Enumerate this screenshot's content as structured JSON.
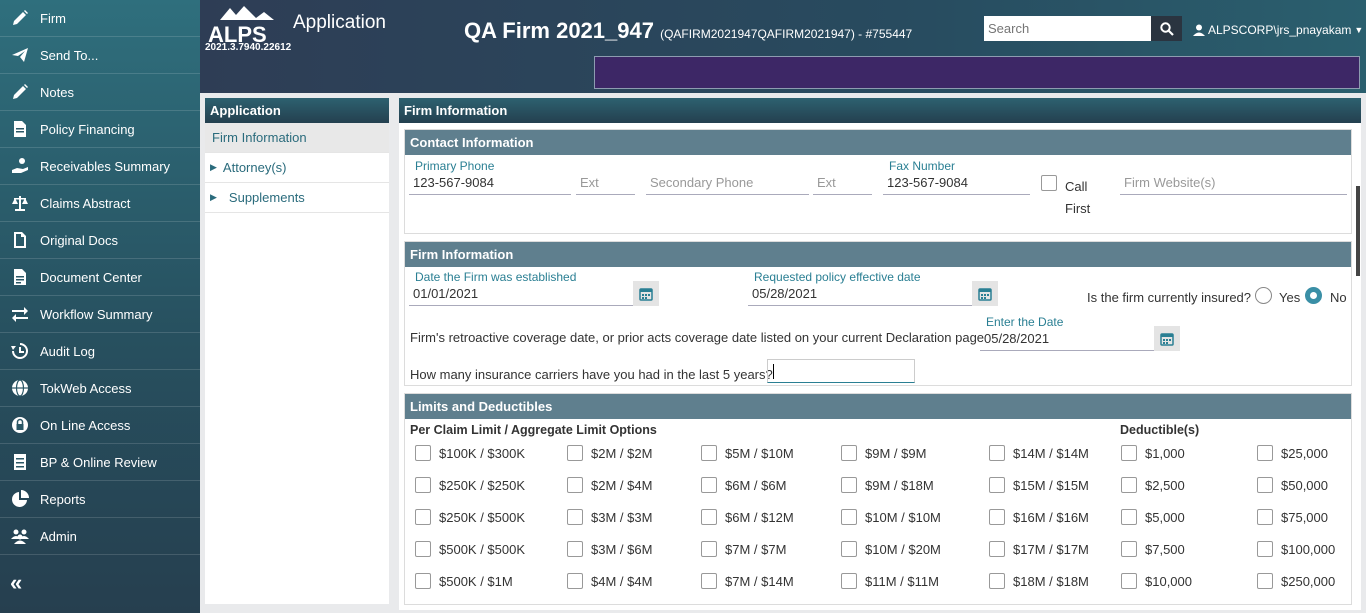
{
  "sidebar": {
    "items": [
      {
        "label": "Firm",
        "icon": "pencil-icon"
      },
      {
        "label": "Send To...",
        "icon": "paper-plane-icon"
      },
      {
        "label": "Notes",
        "icon": "pencil-icon"
      },
      {
        "label": "Policy Financing",
        "icon": "document-icon"
      },
      {
        "label": "Receivables Summary",
        "icon": "hand-coin-icon"
      },
      {
        "label": "Claims Abstract",
        "icon": "scale-icon"
      },
      {
        "label": "Original Docs",
        "icon": "file-icon"
      },
      {
        "label": "Document Center",
        "icon": "file-text-icon"
      },
      {
        "label": "Workflow Summary",
        "icon": "exchange-icon"
      },
      {
        "label": "Audit Log",
        "icon": "history-icon"
      },
      {
        "label": "TokWeb Access",
        "icon": "globe-icon"
      },
      {
        "label": "On Line Access",
        "icon": "lock-icon"
      },
      {
        "label": "BP & Online Review",
        "icon": "list-doc-icon"
      },
      {
        "label": "Reports",
        "icon": "pie-chart-icon"
      },
      {
        "label": "Admin",
        "icon": "users-icon"
      }
    ],
    "collapse_label": "«"
  },
  "header": {
    "logo_text": "ALPS",
    "app_title": "Application",
    "version": "2021.3.7940.22612",
    "firm_title": "QA Firm 2021_947",
    "firm_sub": "(QAFIRM2021947QAFIRM2021947) - #755447",
    "search_placeholder": "Search",
    "user": "ALPSCORP\\jrs_pnayakam"
  },
  "appnav": {
    "title": "Application",
    "items": [
      {
        "label": "Firm Information"
      },
      {
        "label": "Attorney(s)"
      },
      {
        "label": "Supplements"
      }
    ]
  },
  "main": {
    "title": "Firm Information",
    "contact": {
      "title": "Contact Information",
      "primary_phone_label": "Primary Phone",
      "primary_phone": "123-567-9084",
      "ext_placeholder": "Ext",
      "secondary_placeholder": "Secondary Phone",
      "ext2_placeholder": "Ext",
      "fax_label": "Fax Number",
      "fax": "123-567-9084",
      "call_first": "Call First",
      "website_placeholder": "Firm Website(s)"
    },
    "firm": {
      "title": "Firm Information",
      "established_label": "Date the Firm was established",
      "established": "01/01/2021",
      "effective_label": "Requested policy effective date",
      "effective": "05/28/2021",
      "insured_q": "Is the firm currently insured?",
      "yes": "Yes",
      "no": "No",
      "insured_value": "No",
      "retro_q": "Firm's retroactive coverage date, or prior acts coverage date listed on your current Declaration page",
      "retro_label": "Enter the Date",
      "retro": "05/28/2021",
      "carriers_q": "How many insurance carriers have you had in the last 5 years?"
    },
    "limits": {
      "title": "Limits and Deductibles",
      "limits_header": "Per Claim Limit / Aggregate Limit Options",
      "deductibles_header": "Deductible(s)",
      "columns": [
        [
          "$100K / $300K",
          "$250K / $250K",
          "$250K / $500K",
          "$500K / $500K",
          "$500K / $1M"
        ],
        [
          "$2M / $2M",
          "$2M / $4M",
          "$3M / $3M",
          "$3M / $6M",
          "$4M / $4M"
        ],
        [
          "$5M / $10M",
          "$6M / $6M",
          "$6M / $12M",
          "$7M / $7M",
          "$7M / $14M"
        ],
        [
          "$9M / $9M",
          "$9M / $18M",
          "$10M / $10M",
          "$10M / $20M",
          "$11M / $11M"
        ],
        [
          "$14M / $14M",
          "$15M / $15M",
          "$16M / $16M",
          "$17M / $17M",
          "$18M / $18M"
        ]
      ],
      "deductibles": [
        [
          "$1,000",
          "$2,500",
          "$5,000",
          "$7,500",
          "$10,000"
        ],
        [
          "$25,000",
          "$50,000",
          "$75,000",
          "$100,000",
          "$250,000"
        ]
      ]
    }
  },
  "colors": {
    "banner": "#3d2766",
    "sidebar_top": "#2f6f7d",
    "accent": "#3a8fa6"
  }
}
